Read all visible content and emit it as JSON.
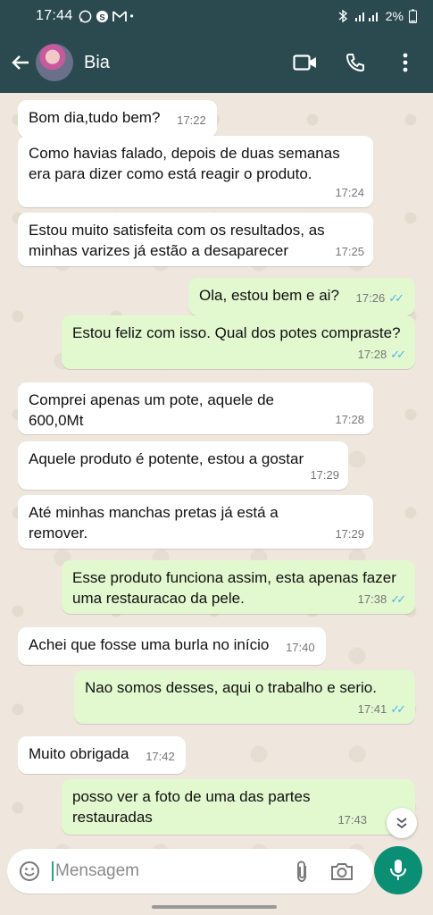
{
  "status_bar": {
    "time": "17:44",
    "notification_icons": [
      "whatsapp-icon",
      "skype-icon",
      "gmail-icon"
    ],
    "dot": "•",
    "battery": "2%"
  },
  "header": {
    "contact_name": "Bia"
  },
  "messages": [
    {
      "dir": "in",
      "text": "Bom dia,tudo bem?",
      "time": "17:22"
    },
    {
      "dir": "in",
      "text": "Como havias falado, depois de duas semanas era para dizer como está reagir o produto.",
      "time": "17:24"
    },
    {
      "dir": "in",
      "text": "Estou muito satisfeita com os resultados, as minhas varizes já estão a desaparecer",
      "time": "17:25"
    },
    {
      "dir": "out",
      "text": "Ola, estou bem e ai?",
      "time": "17:26"
    },
    {
      "dir": "out",
      "text": "Estou feliz com isso. Qual dos potes compraste?",
      "time": "17:28"
    },
    {
      "dir": "in",
      "text": "Comprei apenas um pote, aquele de 600,0Mt",
      "time": "17:28"
    },
    {
      "dir": "in",
      "text": "Aquele produto é potente,  estou a gostar",
      "time": "17:29"
    },
    {
      "dir": "in",
      "text": "Até minhas manchas pretas já está a remover.",
      "time": "17:29"
    },
    {
      "dir": "out",
      "text": "Esse produto funciona assim, esta apenas fazer uma restauracao da pele.",
      "time": "17:38"
    },
    {
      "dir": "in",
      "text": "Achei que fosse uma burla no início",
      "time": "17:40"
    },
    {
      "dir": "out",
      "text": "Nao somos desses, aqui o trabalho e serio.",
      "time": "17:41"
    },
    {
      "dir": "in",
      "text": "Muito obrigada",
      "time": "17:42"
    },
    {
      "dir": "out",
      "text": "posso ver a foto de uma das partes restauradas",
      "time": "17:43"
    }
  ],
  "input": {
    "placeholder": "Mensagem"
  },
  "colors": {
    "header": "#2a4a50",
    "outgoing_bubble": "#e2f8cf",
    "incoming_bubble": "#ffffff",
    "read_ticks": "#4fb6ec",
    "mic_button": "#0b8f74"
  }
}
